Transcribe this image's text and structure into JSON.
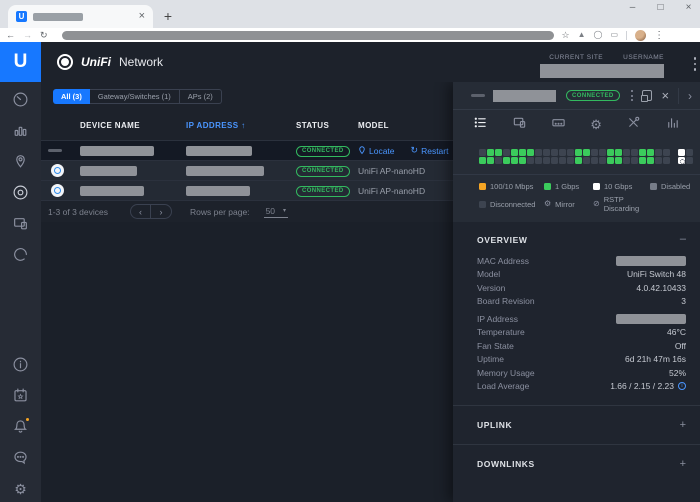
{
  "colors": {
    "accent_blue": "#1778ff",
    "link_blue": "#4a96ff",
    "status_green": "#33b95f",
    "notification_orange": "#f5a524"
  },
  "icons": {
    "back": "←",
    "forward": "→",
    "reload": "↻",
    "star": "☆",
    "menu": "⋮",
    "minimize": "–",
    "maximize": "□",
    "close": "×",
    "new_tab": "+",
    "sort_asc": "↑",
    "collapse": "–",
    "expand": "+",
    "prev": "‹",
    "next": "›",
    "chevron_right": "›",
    "restart": "↻",
    "select_caret": "▾",
    "mirror": "⚙",
    "rstp": "⊘",
    "info": "i"
  },
  "browser": {
    "logo_letter": "U"
  },
  "header": {
    "logo_letter": "U",
    "brand_unifi": "UniFi",
    "brand_network": "Network",
    "current_site_label": "CURRENT SITE",
    "username_label": "USERNAME"
  },
  "tabs": {
    "items": [
      {
        "label": "All (3)",
        "active": true
      },
      {
        "label": "Gateway/Switches (1)",
        "active": false
      },
      {
        "label": "APs (2)",
        "active": false
      }
    ]
  },
  "table": {
    "headers": {
      "device_name": "DEVICE NAME",
      "ip_address": "IP ADDRESS",
      "status": "STATUS",
      "model": "MODEL"
    },
    "rows": [
      {
        "device_type": "switch",
        "selected": true,
        "status": "CONNECTED",
        "name_redacted": true,
        "ip_redacted": true,
        "actions": {
          "locate": "Locate",
          "restart": "Restart"
        }
      },
      {
        "device_type": "ap",
        "selected": false,
        "status": "CONNECTED",
        "name_redacted": true,
        "ip_redacted": true,
        "model": "UniFi AP-nanoHD"
      },
      {
        "device_type": "ap",
        "selected": false,
        "status": "CONNECTED",
        "name_redacted": true,
        "ip_redacted": true,
        "model": "UniFi AP-nanoHD"
      }
    ],
    "pagination": {
      "summary": "1-3 of 3 devices",
      "rows_per_page_label": "Rows per page:",
      "rows_per_page_value": "50"
    }
  },
  "panel": {
    "status": "CONNECTED",
    "ports": {
      "colors": {
        "100m": "#f5a524",
        "1g": "#3bcb5c",
        "10g": "#ffffff",
        "off": "#3d4450",
        "disabled": "#767c88"
      },
      "rows": [
        {
          "main": [
            "off",
            "1g",
            "1g",
            "off",
            "1g",
            "1g",
            "1g",
            "off",
            "off",
            "off",
            "off",
            "off",
            "1g",
            "1g",
            "off",
            "off",
            "1g",
            "1g",
            "off",
            "off",
            "1g",
            "1g",
            "off",
            "off"
          ],
          "sfp": [
            "10g",
            "off"
          ]
        },
        {
          "main": [
            "1g",
            "1g",
            "off",
            "1g",
            "1g",
            "1g",
            "off",
            "off",
            "off",
            "off",
            "off",
            "off",
            "1g",
            "off",
            "off",
            "off",
            "1g",
            "1g",
            "off",
            "off",
            "1g",
            "1g",
            "off",
            "off"
          ],
          "sfp": [
            "10g_mirror",
            "off"
          ]
        }
      ]
    },
    "legend": [
      {
        "swatch": "100m",
        "label": "100/10 Mbps"
      },
      {
        "swatch": "1g",
        "label": "1 Gbps"
      },
      {
        "swatch": "10g",
        "label": "10 Gbps"
      },
      {
        "swatch": "disabled",
        "label": "Disabled"
      },
      {
        "swatch": "off",
        "label": "Disconnected"
      },
      {
        "icon": "mirror",
        "label": "Mirror"
      },
      {
        "icon": "rstp",
        "label": "RSTP Discarding"
      }
    ],
    "overview": {
      "title": "OVERVIEW",
      "rows": [
        {
          "label": "MAC Address",
          "redacted": true
        },
        {
          "label": "Model",
          "value": "UniFi Switch 48"
        },
        {
          "label": "Version",
          "value": "4.0.42.10433"
        },
        {
          "label": "Board Revision",
          "value": "3"
        },
        {
          "label": "IP Address",
          "redacted": true,
          "group_break": true
        },
        {
          "label": "Temperature",
          "value": "46°C"
        },
        {
          "label": "Fan State",
          "value": "Off"
        },
        {
          "label": "Uptime",
          "value": "6d 21h 47m 16s"
        },
        {
          "label": "Memory Usage",
          "value": "52%"
        },
        {
          "label": "Load Average",
          "value": "1.66 / 2.15 / 2.23",
          "info": true
        }
      ]
    },
    "sections": [
      {
        "title": "UPLINK"
      },
      {
        "title": "DOWNLINKS"
      }
    ]
  }
}
